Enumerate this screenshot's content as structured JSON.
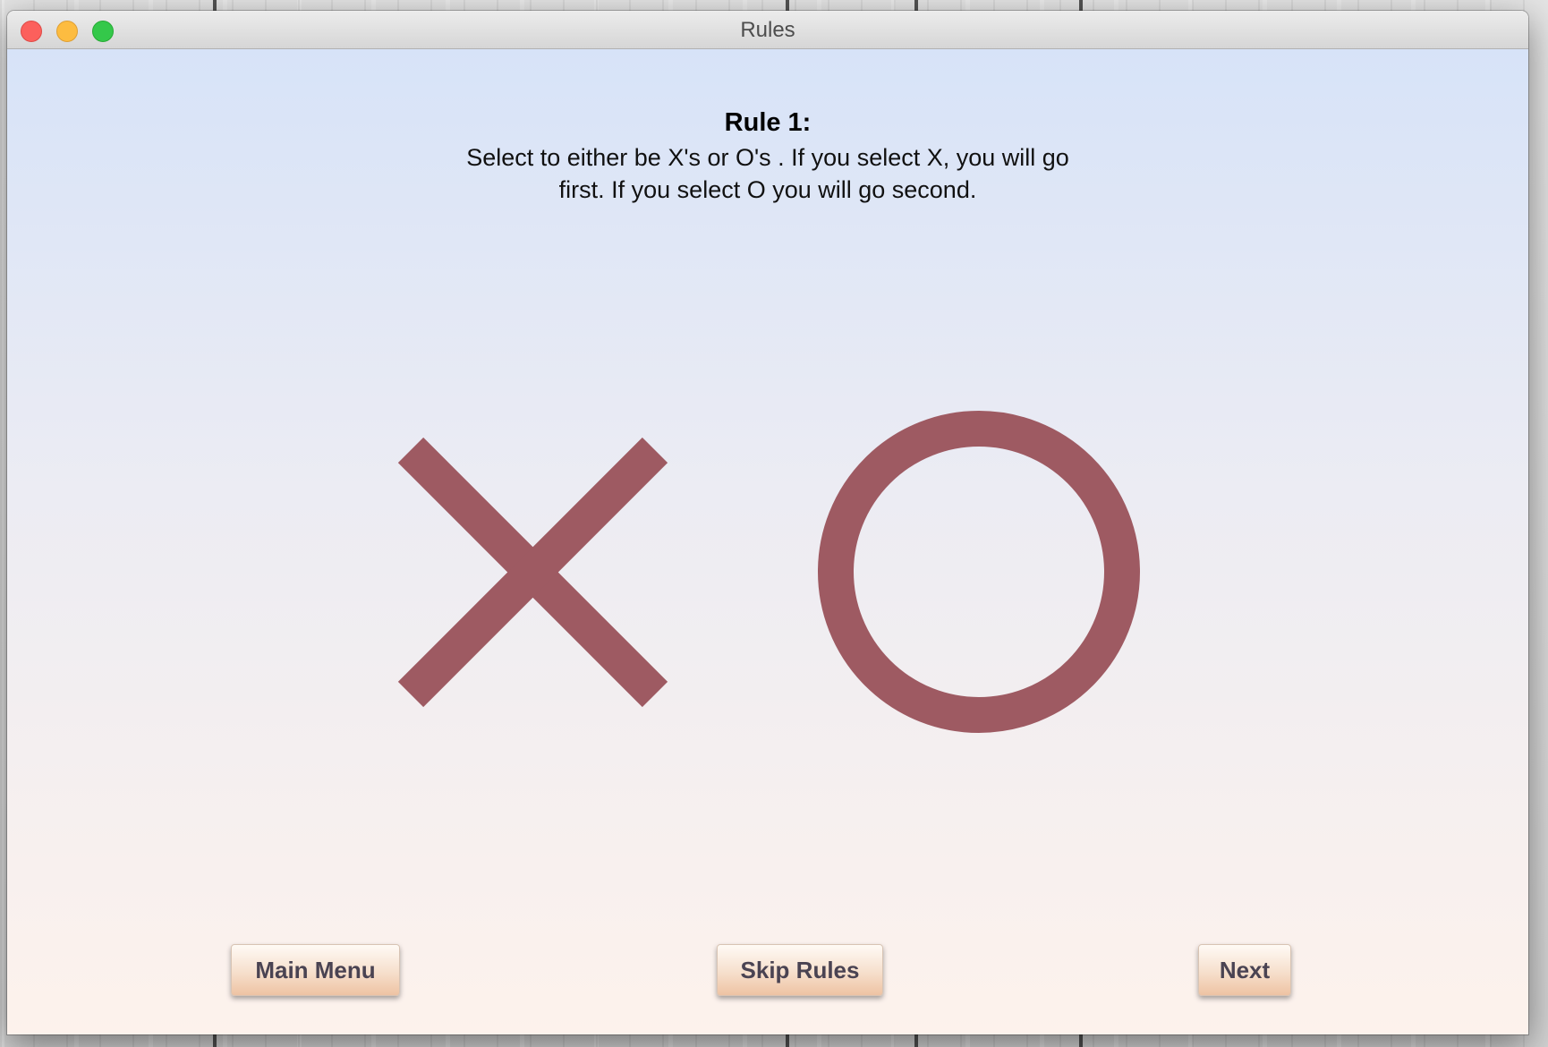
{
  "window": {
    "title": "Rules"
  },
  "rule": {
    "heading": "Rule 1:",
    "text": "Select to either be X's or O's . If you select X, you will go first. If you select O you will go second."
  },
  "illustration": {
    "symbols": [
      "X",
      "O"
    ],
    "color": "#9e5a62"
  },
  "buttons": {
    "main_menu": "Main Menu",
    "skip_rules": "Skip Rules",
    "next": "Next"
  },
  "colors": {
    "button_text": "#4a4352",
    "background_top": "#d7e3f8",
    "background_bottom": "#fdf2ec"
  }
}
